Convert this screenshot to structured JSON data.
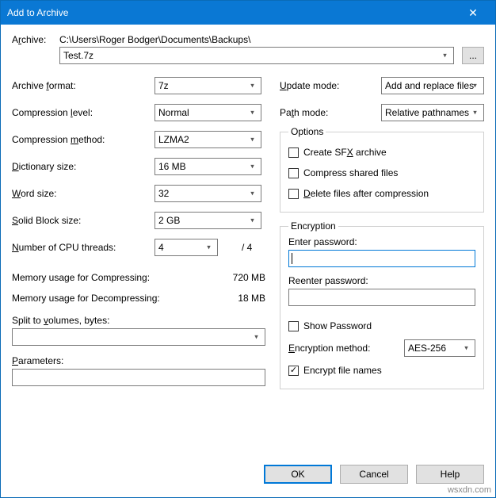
{
  "window": {
    "title": "Add to Archive"
  },
  "archive": {
    "label_pre": "A",
    "label_u": "r",
    "label_post": "chive:",
    "path": "C:\\Users\\Roger Bodger\\Documents\\Backups\\",
    "file": "Test.7z",
    "browse": "..."
  },
  "left": {
    "format": {
      "pre": "Archive ",
      "u": "f",
      "post": "ormat:",
      "value": "7z"
    },
    "level": {
      "pre": "Compression ",
      "u": "l",
      "post": "evel:",
      "value": "Normal"
    },
    "method": {
      "pre": "Compression ",
      "u": "m",
      "post": "ethod:",
      "value": "LZMA2"
    },
    "dict": {
      "pre": "",
      "u": "D",
      "post": "ictionary size:",
      "value": "16 MB"
    },
    "word": {
      "pre": "",
      "u": "W",
      "post": "ord size:",
      "value": "32"
    },
    "block": {
      "pre": "",
      "u": "S",
      "post": "olid Block size:",
      "value": "2 GB"
    },
    "cpu": {
      "pre": "",
      "u": "N",
      "post": "umber of CPU threads:",
      "value": "4",
      "max": "/ 4"
    },
    "mem_c": {
      "label": "Memory usage for Compressing:",
      "value": "720 MB"
    },
    "mem_d": {
      "label": "Memory usage for Decompressing:",
      "value": "18 MB"
    },
    "split": {
      "pre": "Split to ",
      "u": "v",
      "post": "olumes, bytes:",
      "value": ""
    },
    "params": {
      "pre": "",
      "u": "P",
      "post": "arameters:",
      "value": ""
    }
  },
  "right": {
    "update": {
      "pre": "",
      "u": "U",
      "post": "pdate mode:",
      "value": "Add and replace files"
    },
    "path": {
      "pre": "Pa",
      "u": "t",
      "post": "h mode:",
      "value": "Relative pathnames"
    },
    "options_legend": "Options",
    "opt_sfx": {
      "pre": "Create SF",
      "u": "X",
      "post": " archive",
      "checked": false
    },
    "opt_share": {
      "pre": "Compress shared files",
      "u": "",
      "post": "",
      "checked": false
    },
    "opt_del": {
      "pre": "",
      "u": "D",
      "post": "elete files after compression",
      "checked": false
    },
    "enc_legend": "Encryption",
    "enter_pw": "Enter password:",
    "reenter_pw": "Reenter password:",
    "show_pw": {
      "label": "Show Password",
      "checked": false
    },
    "enc_method": {
      "pre": "",
      "u": "E",
      "post": "ncryption method:",
      "value": "AES-256"
    },
    "enc_names": {
      "label": "Encrypt file names",
      "checked": true
    }
  },
  "buttons": {
    "ok": "OK",
    "cancel": "Cancel",
    "help": "Help"
  },
  "watermark": "wsxdn.com"
}
